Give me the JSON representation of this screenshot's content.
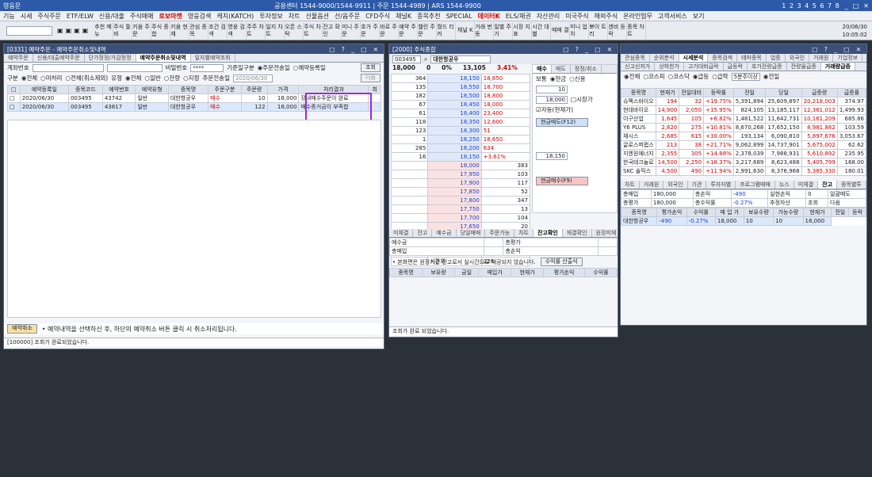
{
  "app": {
    "title": "영웅문",
    "center": "공용센터 1544-9000/1544-9911 | 주문 1544-4989 | ARS 1544-9900",
    "nums": "1 2 3 4 5 6 7 8",
    "date": "20/06/30",
    "time": "10:05:02"
  },
  "menu": [
    "기능",
    "시세",
    "주식주문",
    "ETF/ELW",
    "신용/대출",
    "주식매매",
    "로보마켓",
    "영웅검색",
    "캐치(KATCH)",
    "투자정보",
    "차트",
    "선물옵션",
    "선/옵주문",
    "CFD주식",
    "채널K",
    "종목추천",
    "SPECIAL",
    "데이터K",
    "ELS/채권",
    "자산관리",
    "미국주식",
    "해외주식",
    "온라인업무",
    "고객서비스",
    "보기"
  ],
  "toolbar": [
    "추천 메뉴",
    "주식 툴바",
    "키움 주문",
    "주식 종합",
    "키움 현재",
    "관심 종목",
    "조건 검색",
    "영웅 검색",
    "주주 차트",
    "일지 차트",
    "오픈 스탁",
    "주식 차트",
    "잔고 확인",
    "미니 주문",
    "호가 주문",
    "바로 주문",
    "예약 주문",
    "챌린 주문",
    "월드 티커",
    "채널 K",
    "거래 번동",
    "일별 주가",
    "시장 지표",
    "시간 대별",
    "매매 결",
    "미니 업차",
    "뽀이 트리",
    "겐비 등락",
    "종목 차트"
  ],
  "w1": {
    "title": "[0331] 예약주문 - 예약주문취소및내역",
    "tabs": [
      "예약주문",
      "신용/대출예약주문",
      "단가정정/가감정정",
      "예약주문취소및내역",
      "일자별예약조회"
    ],
    "r1": {
      "acct_label": "계좌번호",
      "pw_label": "비밀번호",
      "pw": "****",
      "base_label": "기준일구분",
      "o1": "주문전송일",
      "o2": "예약등록일",
      "search": "조회"
    },
    "r2": {
      "kind": "구분",
      "a": "전체",
      "b": "미처리",
      "c": "전체(취소제외)",
      "type": "유형",
      "t1": "전체",
      "t2": "일반",
      "t3": "잔량",
      "t4": "지정",
      "sent": "주문전송일",
      "date": "2020/06/30",
      "next": "다음"
    },
    "headers": [
      "예약등록일",
      "종목코드",
      "예약번호",
      "예약유형",
      "종목명",
      "주문구분",
      "주문량",
      "가격",
      "처리결과",
      "최"
    ],
    "rows": [
      [
        "2020/06/30",
        "003495",
        "43742",
        "일반",
        "대한항공우",
        "매수",
        "10",
        "18,000",
        "장내매수주문이 완료"
      ],
      [
        "2020/06/30",
        "003495",
        "43817",
        "일반",
        "대한항공우",
        "매수",
        "122",
        "18,000",
        "매수증거금이 부족합"
      ]
    ],
    "cancel": "예약취소",
    "hint": "• 예약내역을 선택하신 후, 하단의 예약취소 버튼 클릭 시 취소처리됩니다.",
    "status": "[100000] 조회가 완료되었습니다."
  },
  "w2": {
    "title": "[2000] 주식종합",
    "code": "003495",
    "name": "대한항공우",
    "price": "18,000",
    "diff": "0",
    "pct": "0%",
    "vol": "13,105",
    "rate": "3.41%",
    "asks": [
      [
        "364",
        "18,150",
        "18,650"
      ],
      [
        "135",
        "18,550",
        "18,700"
      ],
      [
        "182",
        "18,500",
        "18,800"
      ],
      [
        "67",
        "18,450",
        "18,000"
      ],
      [
        "61",
        "18,400",
        "23,400"
      ],
      [
        "118",
        "18,350",
        "12,600"
      ],
      [
        "123",
        "18,300",
        "51"
      ],
      [
        "1",
        "18,250",
        "18,650"
      ],
      [
        "285",
        "18,200",
        "634"
      ],
      [
        "16",
        "18,150",
        "+3.61%"
      ]
    ],
    "bids": [
      [
        "18,000",
        "383"
      ],
      [
        "17,950",
        "103"
      ],
      [
        "17,900",
        "117"
      ],
      [
        "17,850",
        "52"
      ],
      [
        "17,800",
        "347"
      ],
      [
        "17,750",
        "13"
      ],
      [
        "17,700",
        "104"
      ],
      [
        "17,650",
        "20"
      ],
      [
        "17,600",
        "19"
      ],
      [
        "17,550",
        "31"
      ]
    ],
    "tot": [
      "1,352",
      "10:04:59",
      "1,189",
      "226"
    ],
    "timelabel": "시간외",
    "order": {
      "tabs": [
        "매수",
        "매도",
        "정정/취소"
      ],
      "code": "5211-2523",
      "cash": "현금",
      "credit": "신용",
      "kind": "보통",
      "qty": "10",
      "price": "18,000",
      "auto": "자동(현재가)",
      "market": "시장가",
      "btn1": "현금매도(F12)",
      "btn2": "현금매수(F9)",
      "price2": "18,150"
    },
    "bottom_tabs": [
      "미체결",
      "잔고",
      "예수금",
      "당일매매",
      "주문가능",
      "차트",
      "잔고확인",
      "체결확인",
      "원장미체"
    ],
    "bl": [
      "예수금",
      "총매입",
      "총평가",
      "총손익",
      "추정자산"
    ],
    "note": "• 본화면은 원장기준 잔고로서 실시간으로 재공되지 않습니다.",
    "calc": "수익률 산출식",
    "bh": [
      "종목명",
      "보유량",
      "금일",
      "매입가",
      "현재가",
      "평가손익",
      "수익률"
    ],
    "status": "조회가 완료 되었습니다."
  },
  "w3": {
    "tabs": [
      "관심종목",
      "순위분석",
      "시세분석",
      "종목검색",
      "테마종목",
      "업종",
      "외국인",
      "거래원",
      "기업정보"
    ],
    "subtabs": [
      "신고신저가",
      "상하한가",
      "고가대비급락",
      "급등락",
      "호가잔량급증",
      "잔량율급증",
      "거래량급증"
    ],
    "filters": {
      "a": "전체",
      "b": "코스피",
      "c": "코스닥",
      "d": "급등",
      "e": "급락",
      "f": "5분주이상",
      "g": "전일",
      "h": "분",
      "i": "1",
      "j": "자동"
    },
    "headers": [
      "종목명",
      "현재가",
      "전일대비",
      "등락률",
      "전일",
      "당일",
      "급증량",
      "급증률"
    ],
    "rows": [
      [
        "슈펙스바이오",
        "194",
        "32",
        "+19.75%",
        "5,391,894",
        "25,609,897",
        "20,218,003",
        "374.97"
      ],
      [
        "현대바이오",
        "14,900",
        "2,050",
        "+15.95%",
        "824,105",
        "13,185,117",
        "12,361,012",
        "1,499.93"
      ],
      [
        "이구산업",
        "1,645",
        "105",
        "+6.82%",
        "1,481,522",
        "11,642,731",
        "10,161,209",
        "685.86"
      ],
      [
        "Y6 PLUS",
        "2,820",
        "275",
        "+10.81%",
        "8,670,268",
        "17,652,150",
        "8,981,882",
        "103.59"
      ],
      [
        "채시스",
        "2,685",
        "615",
        "+30.00%",
        "193,134",
        "6,090,810",
        "5,897,676",
        "3,053.67"
      ],
      [
        "글로스퍼랩스",
        "213",
        "38",
        "+21.71%",
        "9,062,899",
        "14,737,901",
        "5,675,002",
        "62.62"
      ],
      [
        "지엔원에너지",
        "2,355",
        "305",
        "+14.88%",
        "2,378,039",
        "7,988,931",
        "5,610,892",
        "235.95"
      ],
      [
        "한국테크놀로",
        "14,500",
        "2,250",
        "+18.37%",
        "3,217,689",
        "8,623,488",
        "5,405,799",
        "168.00"
      ],
      [
        "SKC 솔믹스",
        "4,500",
        "490",
        "+11.94%",
        "2,991,630",
        "8,376,968",
        "5,385,330",
        "180.01"
      ]
    ],
    "tabs2": [
      "차트",
      "거래원",
      "외국인",
      "기관",
      "투자자별",
      "프로그램매매",
      "뉴스",
      "미체결",
      "잔고",
      "종목별투"
    ],
    "sum": {
      "a": "총매입",
      "av": "180,000",
      "b": "총손익",
      "bv": "-490",
      "c": "실현손익",
      "cv": "0",
      "d": "일괄매도",
      "e": "총평가",
      "ev": "180,000",
      "f": "총수익률",
      "fv": "-0.27%",
      "g": "추정자산",
      "h": "조회",
      "i": "다음"
    },
    "hdr": [
      "종목명",
      "평가손익",
      "수익률",
      "매 입 가",
      "보유수량",
      "가능수량",
      "현재가",
      "전일",
      "등락"
    ],
    "row": [
      "대한항공우",
      "-490",
      "-0.27%",
      "18,000",
      "10",
      "10",
      "18,000"
    ]
  }
}
